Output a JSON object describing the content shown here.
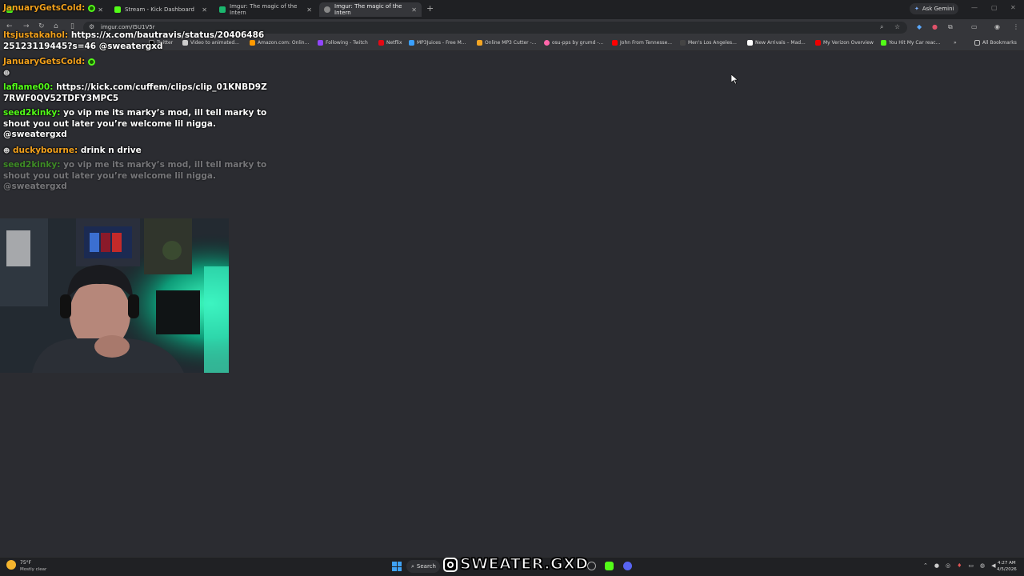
{
  "browser": {
    "tabs": [
      {
        "title": "",
        "favicon_color": "#53fc18",
        "active": false
      },
      {
        "title": "Stream - Kick Dashboard",
        "favicon_color": "#53fc18",
        "active": false
      },
      {
        "title": "Imgur: The magic of the Intern",
        "favicon_color": "#1bb76e",
        "active": false
      },
      {
        "title": "Imgur: The magic of the Intern",
        "favicon_color": "#888888",
        "active": true
      }
    ],
    "new_tab": "+",
    "ask_gemini": "Ask Gemini",
    "url": "imgur.com/I5U1V5r",
    "bookmarks": [
      {
        "label": "Twitter",
        "color": "#000000"
      },
      {
        "label": "Video to animated...",
        "color": "#cccccc"
      },
      {
        "label": "Amazon.com: Onlin...",
        "color": "#ff9900"
      },
      {
        "label": "Following - Twitch",
        "color": "#9146ff"
      },
      {
        "label": "Netflix",
        "color": "#e50914"
      },
      {
        "label": "MP3Juices - Free M...",
        "color": "#3aa0ff"
      },
      {
        "label": "Online MP3 Cutter -...",
        "color": "#f5a623"
      },
      {
        "label": "osu-pps by grumd -...",
        "color": "#ff66aa"
      },
      {
        "label": "John From Tennesse...",
        "color": "#ff0000"
      },
      {
        "label": "Men's Los Angeles...",
        "color": "#444444"
      },
      {
        "label": "New Arrivals – Mad...",
        "color": "#ffffff"
      },
      {
        "label": "My Verizon Overview",
        "color": "#ee0000"
      },
      {
        "label": "You Hit My Car reac...",
        "color": "#53fc18"
      }
    ],
    "all_bookmarks": "All Bookmarks"
  },
  "chat": {
    "messages": [
      {
        "user": "JanuaryGetsCold:",
        "text": "",
        "color": "#f2a11c",
        "badge": true,
        "faded": false
      },
      {
        "user": "Itsjustakahol:",
        "text": "https://x.com/bautravis/status/2040648625123119445?s=46 @sweatergxd",
        "color": "#f2a11c",
        "badge": false,
        "faded": false
      },
      {
        "user": "JanuaryGetsCold:",
        "text": "",
        "color": "#f2a11c",
        "badge": true,
        "faded": false
      },
      {
        "user": "laflame00:",
        "text": "https://kick.com/cuffem/clips/clip_01KNBD9Z7RWF0QV52TDFY3MPC5",
        "color": "#53fc18",
        "badge": false,
        "faded": false
      },
      {
        "user": "seed2kinky:",
        "text": "yo vip me its marky’s mod, ill tell marky to shout you out later you’re welcome lil nigga. @sweatergxd",
        "color": "#53fc18",
        "badge": false,
        "faded": false
      },
      {
        "user": "duckybourne:",
        "text": "drink n drive",
        "color": "#f2a11c",
        "badge": false,
        "faded": false
      },
      {
        "user": "seed2kinky:",
        "text": "yo vip me its marky’s mod, ill tell marky to shout you out later you’re welcome lil nigga. @sweatergxd",
        "color": "#53fc18",
        "badge": false,
        "faded": true
      }
    ]
  },
  "taskbar": {
    "weather_temp": "75°F",
    "weather_desc": "Mostly clear",
    "search_label": "Search",
    "handle": "SWEATER.GXD",
    "time": "4:27 AM",
    "date": "4/5/2026"
  }
}
